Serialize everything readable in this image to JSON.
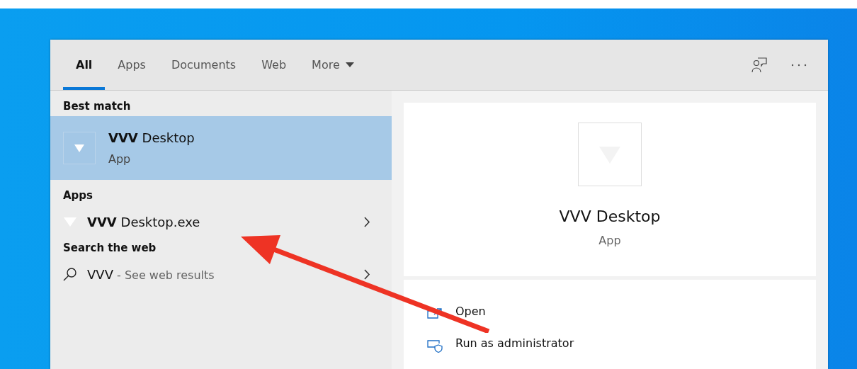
{
  "tabs": [
    {
      "label": "All",
      "selected": true
    },
    {
      "label": "Apps",
      "selected": false
    },
    {
      "label": "Documents",
      "selected": false
    },
    {
      "label": "Web",
      "selected": false
    },
    {
      "label": "More",
      "selected": false,
      "dropdown": true
    }
  ],
  "left_panel": {
    "sections": [
      {
        "heading": "Best match",
        "items": [
          {
            "kind": "best",
            "title": "**VVV** Desktop",
            "subtitle": "App",
            "selected": true
          }
        ]
      },
      {
        "heading": "Apps",
        "items": [
          {
            "kind": "app",
            "title": "**VVV** Desktop.exe",
            "selected": false
          }
        ]
      },
      {
        "heading": "Search the web",
        "items": [
          {
            "kind": "web",
            "title": "VVV",
            "suffix": " - See web results",
            "selected": false
          }
        ]
      }
    ]
  },
  "preview": {
    "title": "VVV Desktop",
    "subtitle": "App",
    "actions": [
      {
        "kind": "open",
        "label": "Open"
      },
      {
        "kind": "admin",
        "label": "Run as administrator"
      }
    ]
  }
}
